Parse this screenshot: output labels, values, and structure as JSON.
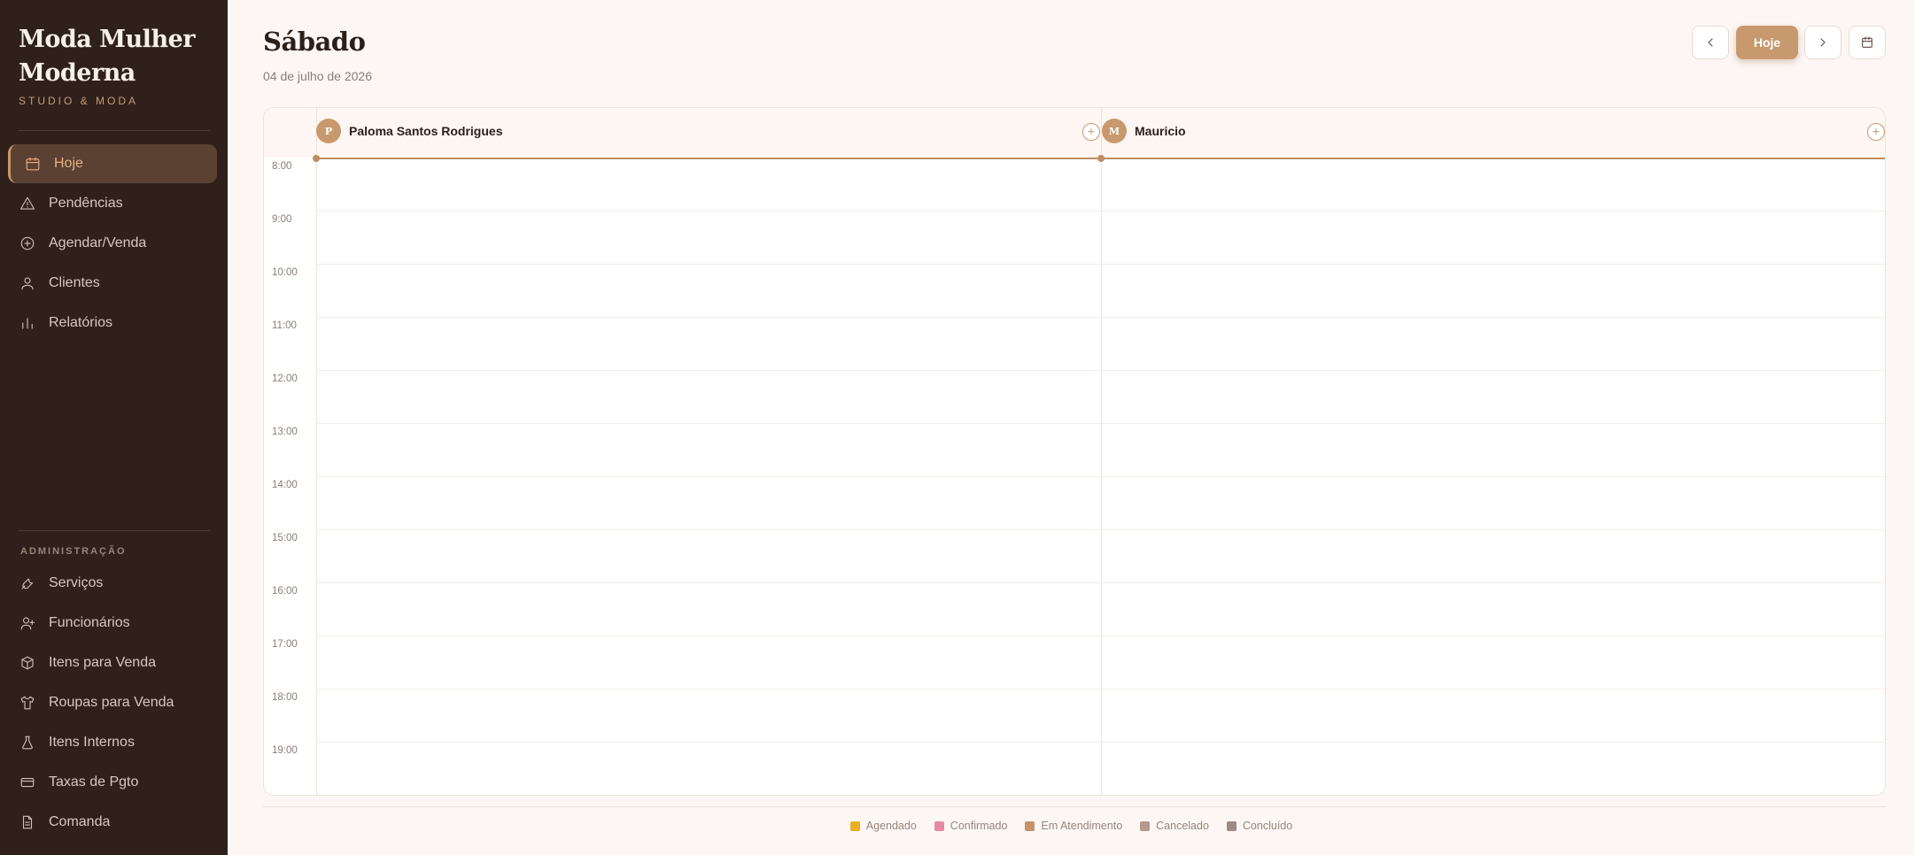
{
  "brand": {
    "title": "Moda Mulher Moderna",
    "subtitle": "STUDIO & MODA"
  },
  "nav": {
    "main": [
      {
        "label": "Hoje",
        "icon": "calendar-icon",
        "active": true
      },
      {
        "label": "Pendências",
        "icon": "warning-icon"
      },
      {
        "label": "Agendar/Venda",
        "icon": "plus-circle-icon"
      },
      {
        "label": "Clientes",
        "icon": "user-icon"
      },
      {
        "label": "Relatórios",
        "icon": "bar-chart-icon"
      }
    ],
    "admin_label": "ADMINISTRAÇÃO",
    "admin": [
      {
        "label": "Serviços",
        "icon": "wrench-icon"
      },
      {
        "label": "Funcionários",
        "icon": "user-plus-icon"
      },
      {
        "label": "Itens para Venda",
        "icon": "box-icon"
      },
      {
        "label": "Roupas para Venda",
        "icon": "shirt-icon"
      },
      {
        "label": "Itens Internos",
        "icon": "flask-icon"
      },
      {
        "label": "Taxas de Pgto",
        "icon": "credit-card-icon"
      },
      {
        "label": "Comanda",
        "icon": "file-icon"
      }
    ]
  },
  "header": {
    "title": "Sábado",
    "date": "04 de julho de 2026",
    "today_label": "Hoje"
  },
  "calendar": {
    "employees": [
      {
        "initial": "P",
        "name": "Paloma Santos Rodrigues"
      },
      {
        "initial": "M",
        "name": "Mauricio"
      }
    ],
    "hours": [
      "8:00",
      "9:00",
      "10:00",
      "11:00",
      "12:00",
      "13:00",
      "14:00",
      "15:00",
      "16:00",
      "17:00",
      "18:00",
      "19:00"
    ]
  },
  "legend": [
    {
      "label": "Agendado",
      "color": "#eab021"
    },
    {
      "label": "Confirmado",
      "color": "#e58aa6"
    },
    {
      "label": "Em Atendimento",
      "color": "#c8916a"
    },
    {
      "label": "Cancelado",
      "color": "#b49a8c"
    },
    {
      "label": "Concluído",
      "color": "#9d8a80"
    }
  ],
  "colors": {
    "sidebar": "#2f201b",
    "accent": "#c8996e",
    "background": "#fcf7f4"
  }
}
